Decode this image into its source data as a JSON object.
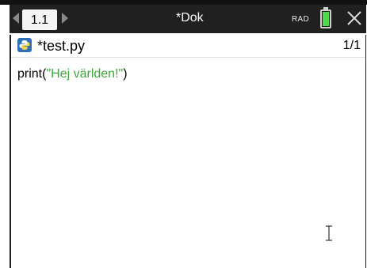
{
  "toolbar": {
    "tab_label": "1.1",
    "document_title": "*Dok",
    "angle_mode": "RAD",
    "battery_color": "#4fd84a"
  },
  "file": {
    "name": "*test.py",
    "page": "1/1",
    "icon": "python-icon"
  },
  "editor": {
    "code_prefix": "print(",
    "code_string": "\"Hej världen!\"",
    "code_suffix": ")",
    "string_color": "#3aa838"
  }
}
